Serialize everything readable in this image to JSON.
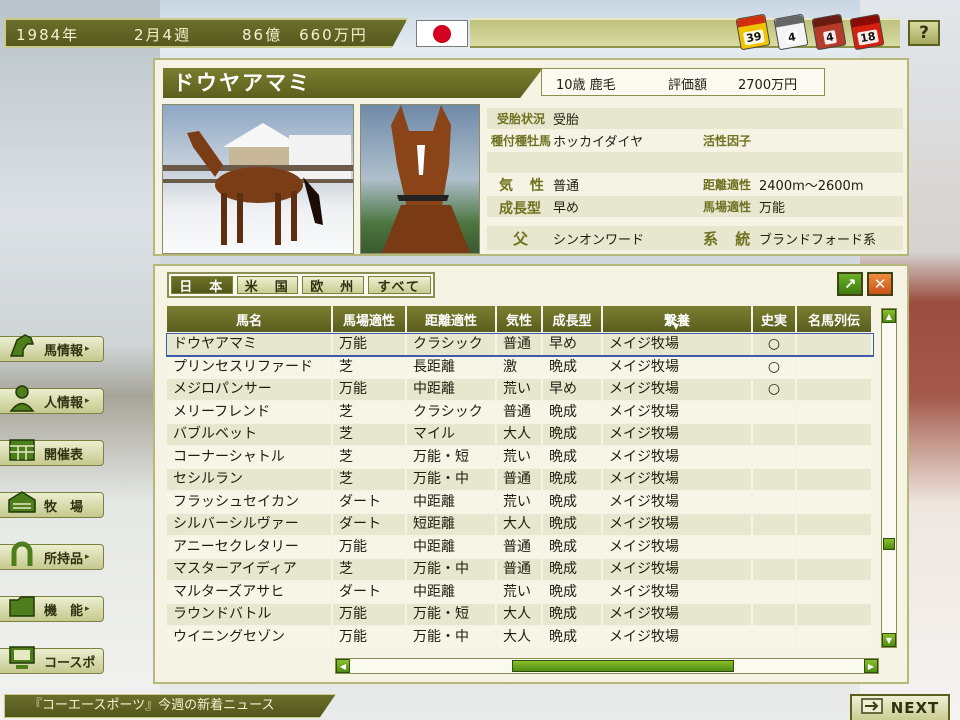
{
  "topbar": {
    "year": "1984年",
    "week": "2月4週",
    "money": "86億　660万円"
  },
  "calendars": [
    "39",
    "4",
    "4",
    "18"
  ],
  "help_label": "?",
  "menu": [
    {
      "label": "馬情報",
      "icon": "horse-head-icon"
    },
    {
      "label": "人情報",
      "icon": "person-icon"
    },
    {
      "label": "開催表",
      "icon": "calendar-icon"
    },
    {
      "label": "牧　場",
      "icon": "stable-icon"
    },
    {
      "label": "所持品",
      "icon": "horseshoe-icon"
    },
    {
      "label": "機　能",
      "icon": "folder-icon"
    },
    {
      "label": "コースポ",
      "icon": "monitor-icon"
    }
  ],
  "horse": {
    "name": "ドウヤアマミ",
    "age_color": "10歳 鹿毛",
    "value_label": "評価額",
    "value": "2700万円",
    "pregnancy_label": "受胎状況",
    "pregnancy": "受胎",
    "mate_label": "種付種牡馬",
    "mate": "ホッカイダイヤ",
    "factor_label": "活性因子",
    "factor": "",
    "temper_label": "気 性",
    "temper": "普通",
    "distance_label": "距離適性",
    "distance": "2400m～2600m",
    "growth_label": "成長型",
    "growth": "早め",
    "track_label": "馬場適性",
    "track": "万能",
    "sire_label": "父",
    "sire": "シンオンワード",
    "line_label": "系 統",
    "line": "ブランドフォード系"
  },
  "tabs": [
    "日　本",
    "米　国",
    "欧　州",
    "すべて"
  ],
  "table": {
    "headers": [
      "馬名",
      "馬場適性",
      "距離適性",
      "気性",
      "成長型",
      "繋養",
      "史実",
      "名馬列伝"
    ],
    "rows": [
      [
        "ドウヤアマミ",
        "万能",
        "クラシック",
        "普通",
        "早め",
        "メイジ牧場",
        "○",
        ""
      ],
      [
        "プリンセスリファード",
        "芝",
        "長距離",
        "激",
        "晩成",
        "メイジ牧場",
        "○",
        ""
      ],
      [
        "メジロパンサー",
        "万能",
        "中距離",
        "荒い",
        "早め",
        "メイジ牧場",
        "○",
        ""
      ],
      [
        "メリーフレンド",
        "芝",
        "クラシック",
        "普通",
        "晩成",
        "メイジ牧場",
        "",
        ""
      ],
      [
        "バブルベット",
        "芝",
        "マイル",
        "大人",
        "晩成",
        "メイジ牧場",
        "",
        ""
      ],
      [
        "コーナーシャトル",
        "芝",
        "万能・短",
        "荒い",
        "晩成",
        "メイジ牧場",
        "",
        ""
      ],
      [
        "セシルラン",
        "芝",
        "万能・中",
        "普通",
        "晩成",
        "メイジ牧場",
        "",
        ""
      ],
      [
        "フラッシュセイカン",
        "ダート",
        "中距離",
        "荒い",
        "晩成",
        "メイジ牧場",
        "",
        ""
      ],
      [
        "シルバーシルヴァー",
        "ダート",
        "短距離",
        "大人",
        "晩成",
        "メイジ牧場",
        "",
        ""
      ],
      [
        "アニーセクレタリー",
        "万能",
        "中距離",
        "普通",
        "晩成",
        "メイジ牧場",
        "",
        ""
      ],
      [
        "マスターアイディア",
        "芝",
        "万能・中",
        "普通",
        "晩成",
        "メイジ牧場",
        "",
        ""
      ],
      [
        "マルターズアサヒ",
        "ダート",
        "中距離",
        "荒い",
        "晩成",
        "メイジ牧場",
        "",
        ""
      ],
      [
        "ラウンドバトル",
        "万能",
        "万能・短",
        "大人",
        "晩成",
        "メイジ牧場",
        "",
        ""
      ],
      [
        "ウイニングセゾン",
        "万能",
        "万能・中",
        "大人",
        "晩成",
        "メイジ牧場",
        "",
        ""
      ]
    ],
    "selected_row": 0
  },
  "scroll": {
    "vertical_position": 0.72,
    "horizontal_position": 0.55
  },
  "news": "『コーエースポーツ』今週の新着ニュース",
  "next_label": "NEXT",
  "colors": {
    "olive_dark": "#5b5f1d",
    "olive_light": "#c5c98e",
    "scroll_green": "#4f8c12",
    "selection_blue": "#3f5aa8"
  }
}
